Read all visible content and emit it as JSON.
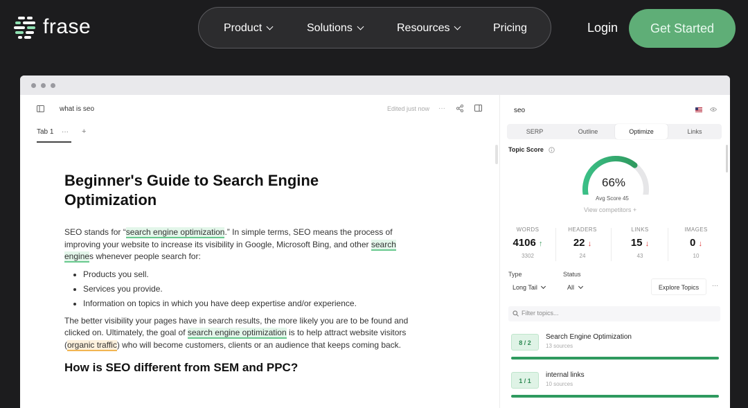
{
  "nav": {
    "logo_text": "frase",
    "items": [
      {
        "label": "Product",
        "has_chevron": true
      },
      {
        "label": "Solutions",
        "has_chevron": true
      },
      {
        "label": "Resources",
        "has_chevron": true
      },
      {
        "label": "Pricing",
        "has_chevron": false
      }
    ],
    "login": "Login",
    "cta": "Get Started"
  },
  "editor": {
    "doc_title": "what is seo",
    "status": "Edited just now",
    "more": "···",
    "tabs": [
      {
        "label": "Tab 1"
      }
    ],
    "tab_more": "···",
    "tab_add": "+",
    "heading": "Beginner's Guide to Search Engine Optimization",
    "p1_a": "SEO stands for “",
    "p1_hl1": "search engine optimization",
    "p1_b": ".” In simple terms, SEO means the process of improving your website to increase its visibility in Google, Microsoft Bing, and other ",
    "p1_hl2": "search engine",
    "p1_c": "s whenever people search for:",
    "bullets": [
      "Products you sell.",
      "Services you provide.",
      "Information on topics in which you have deep expertise and/or experience."
    ],
    "p2_a": "The better visibility your pages have in search results, the more likely you are to be found and clicked on. Ultimately, the goal of ",
    "p2_hl1": "search engine optimization",
    "p2_b": " is to help attract website visitors (",
    "p2_hl2": "organic traffic",
    "p2_c": ") who will become customers, clients or an audience that keeps coming back.",
    "h2": "How is SEO different from SEM and PPC?"
  },
  "panel": {
    "query": "seo",
    "tabs": [
      "SERP",
      "Outline",
      "Optimize",
      "Links"
    ],
    "active_tab": "Optimize",
    "topic_score_label": "Topic Score",
    "score_value": 66,
    "score_text": "66%",
    "avg_score": "Avg Score 45",
    "view_competitors": "View competitors",
    "stats": [
      {
        "label": "WORDS",
        "value": "4106",
        "trend": "up",
        "sub": "3302"
      },
      {
        "label": "HEADERS",
        "value": "22",
        "trend": "down",
        "sub": "24"
      },
      {
        "label": "LINKS",
        "value": "15",
        "trend": "down",
        "sub": "43"
      },
      {
        "label": "IMAGES",
        "value": "0",
        "trend": "down",
        "sub": "10"
      }
    ],
    "type_label": "Type",
    "type_value": "Long Tail",
    "status_label": "Status",
    "status_value": "All",
    "explore_topics": "Explore Topics",
    "more": "···",
    "filter_placeholder": "Filter topics...",
    "topics": [
      {
        "badge": "8 / 2",
        "name": "Search Engine Optimization",
        "sub": "13 sources",
        "progress": 1.0
      },
      {
        "badge": "1 / 1",
        "name": "internal links",
        "sub": "10 sources",
        "progress": 1.0
      }
    ],
    "colors": {
      "accent": "#34a86a",
      "gauge_track": "#e6e6e8",
      "gauge_start": "#3bbf86",
      "gauge_end": "#2f9a5f"
    }
  },
  "colors": {
    "page_bg": "#1c1c1e",
    "cta_bg": "#5fae77",
    "highlight_green": "#67c88d",
    "highlight_orange": "#f2b552"
  }
}
